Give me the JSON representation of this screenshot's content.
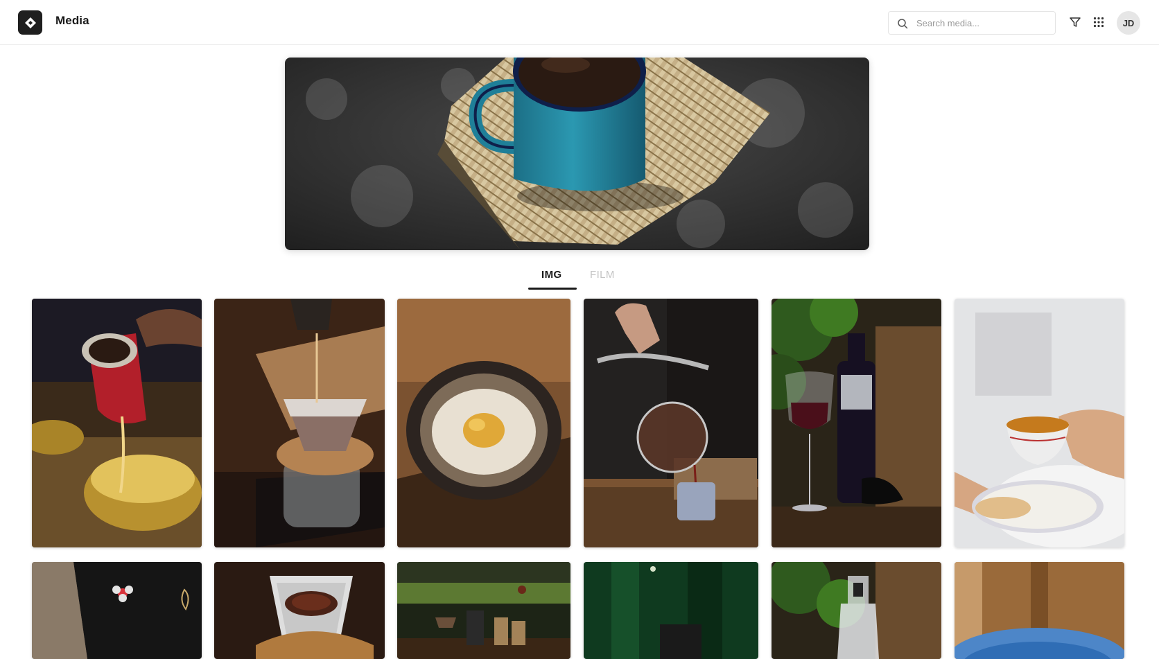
{
  "app": {
    "title": "Media",
    "logo_icon": "diamond-logo-icon"
  },
  "search": {
    "placeholder": "Search media...",
    "value": ""
  },
  "toolbar": {
    "filter_icon": "filter-icon",
    "apps_icon": "grid-apps-icon"
  },
  "user": {
    "initials": "JD"
  },
  "tabs": [
    {
      "label": "IMG",
      "active": true
    },
    {
      "label": "FILM",
      "active": false
    }
  ],
  "hero": {
    "subject": "blue enamel coffee mug on woven mat"
  },
  "gallery": {
    "items": [
      {
        "subject": "pouring from red pitcher into brass bowl"
      },
      {
        "subject": "pour-over coffee dripper on glass server"
      },
      {
        "subject": "plated dish in dark ceramic bowl"
      },
      {
        "subject": "siphon coffee pouring into cup"
      },
      {
        "subject": "red wine glass and bottle"
      },
      {
        "subject": "hand holding teacup and saucer with biscuit"
      },
      {
        "subject": "barista apron with logo"
      },
      {
        "subject": "ground coffee in paper filter"
      },
      {
        "subject": "coffee equipment on green-lit bar"
      },
      {
        "subject": "green bar interior"
      },
      {
        "subject": "clear glass bottle among plants"
      },
      {
        "subject": "blurred blue and wood tones"
      }
    ]
  }
}
